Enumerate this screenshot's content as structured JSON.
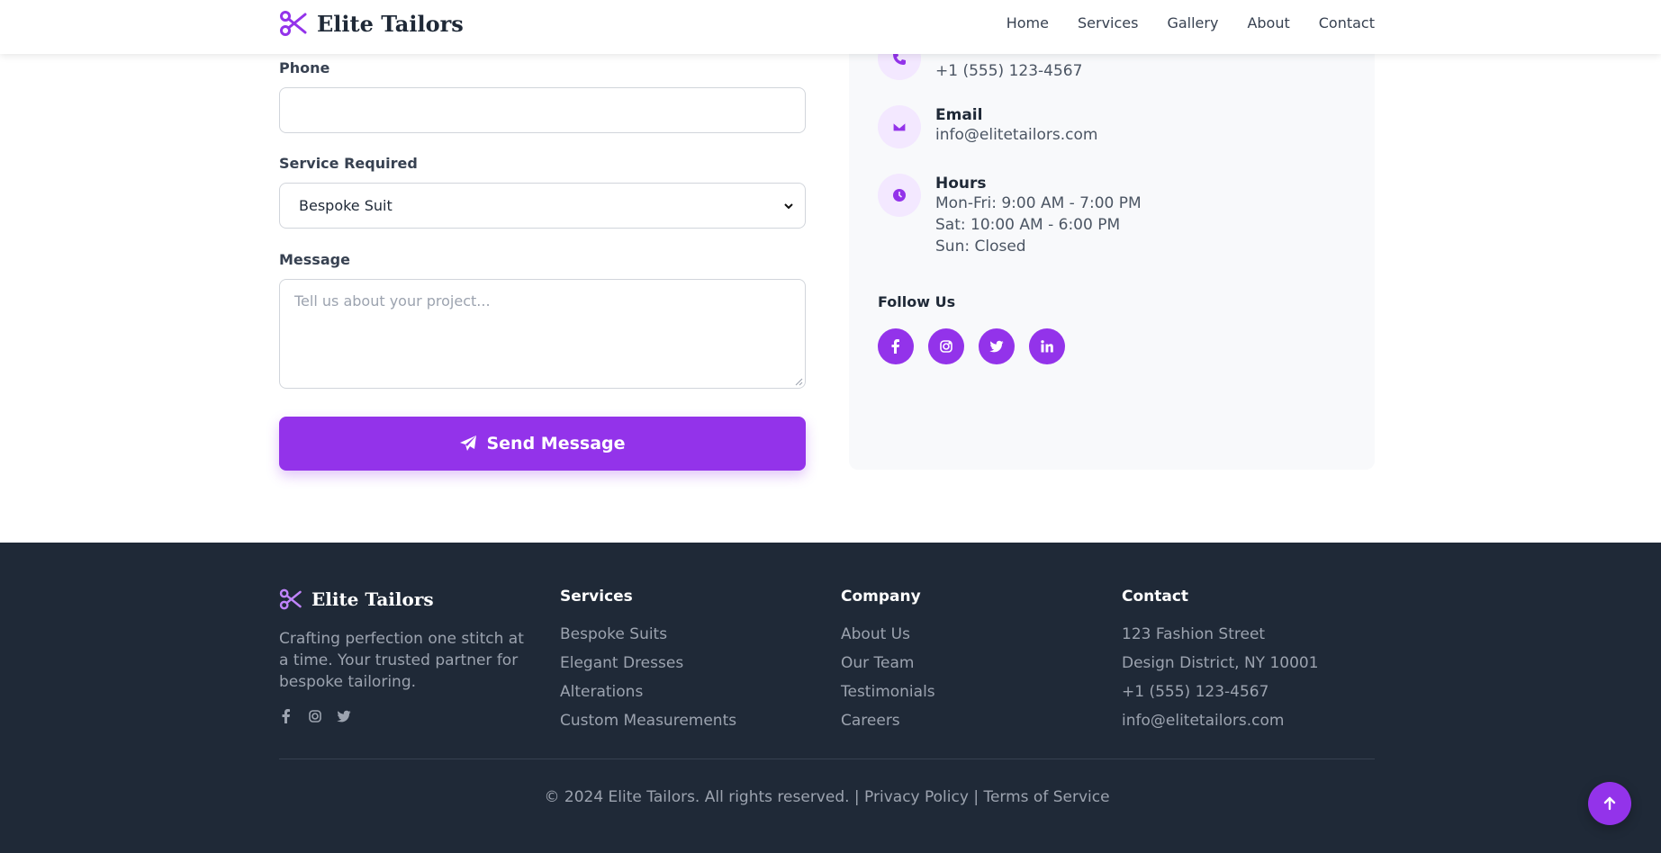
{
  "brand": {
    "name": "Elite Tailors",
    "logo_icon": "scissors-icon"
  },
  "nav": {
    "items": [
      "Home",
      "Services",
      "Gallery",
      "About",
      "Contact"
    ]
  },
  "form": {
    "phone_label": "Phone",
    "phone_value": "",
    "service_label": "Service Required",
    "service_selected": "Bespoke Suit",
    "message_label": "Message",
    "message_placeholder": "Tell us about your project...",
    "submit_label": "Send Message",
    "submit_icon": "paper-plane-icon"
  },
  "contact_card": {
    "phone": {
      "icon": "phone-icon",
      "value": "+1 (555) 123-4567"
    },
    "email": {
      "icon": "envelope-icon",
      "title": "Email",
      "value": "info@elitetailors.com"
    },
    "hours": {
      "icon": "clock-icon",
      "title": "Hours",
      "lines": [
        "Mon-Fri: 9:00 AM - 7:00 PM",
        "Sat: 10:00 AM - 6:00 PM",
        "Sun: Closed"
      ]
    },
    "follow_title": "Follow Us",
    "socials": [
      "facebook-icon",
      "instagram-icon",
      "twitter-icon",
      "linkedin-icon"
    ]
  },
  "footer": {
    "brand_name": "Elite Tailors",
    "tagline": "Crafting perfection one stitch at a time. Your trusted partner for bespoke tailoring.",
    "socials": [
      "facebook-icon",
      "instagram-icon",
      "twitter-icon"
    ],
    "columns": [
      {
        "title": "Services",
        "links": [
          "Bespoke Suits",
          "Elegant Dresses",
          "Alterations",
          "Custom Measurements"
        ]
      },
      {
        "title": "Company",
        "links": [
          "About Us",
          "Our Team",
          "Testimonials",
          "Careers"
        ]
      },
      {
        "title": "Contact",
        "links": [
          "123 Fashion Street",
          "Design District, NY 10001",
          "+1 (555) 123-4567",
          "info@elitetailors.com"
        ]
      }
    ],
    "copyright": "© 2024 Elite Tailors. All rights reserved. | Privacy Policy | Terms of Service"
  },
  "back_to_top_icon": "arrow-up-icon",
  "colors": {
    "accent": "#9333ea",
    "accent_light": "#f3e8ff",
    "footer_bg": "#1f2937",
    "card_bg": "#f8f9fb"
  }
}
